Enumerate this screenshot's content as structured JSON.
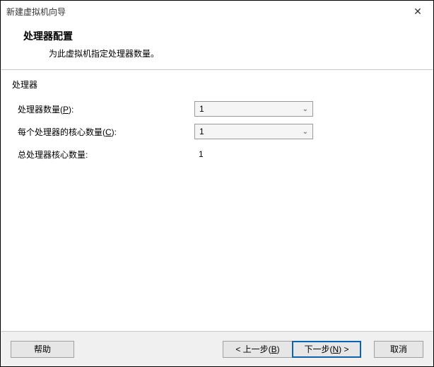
{
  "window": {
    "title": "新建虚拟机向导"
  },
  "header": {
    "title": "处理器配置",
    "subtitle": "为此虚拟机指定处理器数量。"
  },
  "group": {
    "label": "处理器"
  },
  "form": {
    "processorCount": {
      "label_pre": "处理器数量(",
      "mnemonic": "P",
      "label_post": "):",
      "value": "1"
    },
    "coresPerProcessor": {
      "label_pre": "每个处理器的核心数量(",
      "mnemonic": "C",
      "label_post": "):",
      "value": "1"
    },
    "totalCores": {
      "label": "总处理器核心数量:",
      "value": "1"
    }
  },
  "buttons": {
    "help": "帮助",
    "back_pre": "< 上一步(",
    "back_mn": "B",
    "back_post": ")",
    "next_pre": "下一步(",
    "next_mn": "N",
    "next_post": ") >",
    "cancel": "取消"
  }
}
